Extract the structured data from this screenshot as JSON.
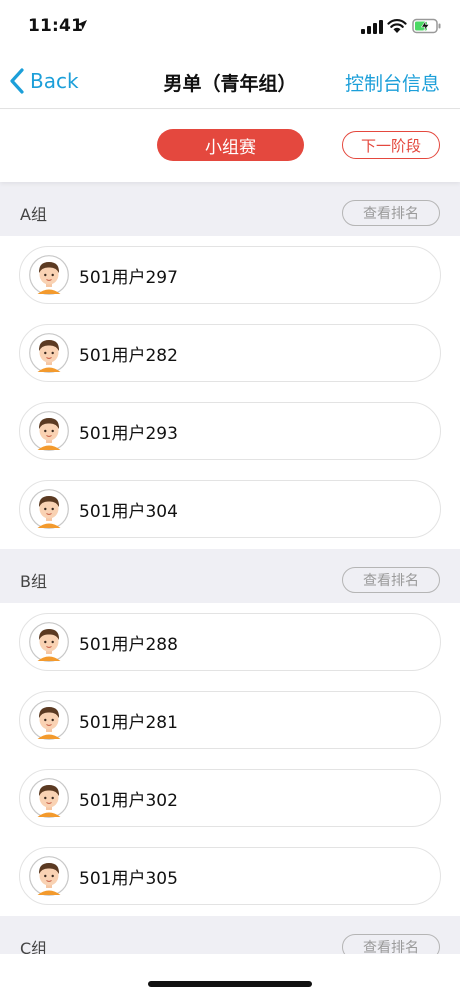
{
  "status_bar": {
    "time": "11:41"
  },
  "nav": {
    "back_label": "Back",
    "title": "男单（青年组）",
    "console_label": "控制台信息"
  },
  "stage": {
    "current": "小组赛",
    "next": "下一阶段"
  },
  "groups": [
    {
      "name": "A组",
      "rank_label": "查看排名",
      "players": [
        {
          "name": "501用户297"
        },
        {
          "name": "501用户282"
        },
        {
          "name": "501用户293"
        },
        {
          "name": "501用户304"
        }
      ]
    },
    {
      "name": "B组",
      "rank_label": "查看排名",
      "players": [
        {
          "name": "501用户288"
        },
        {
          "name": "501用户281"
        },
        {
          "name": "501用户302"
        },
        {
          "name": "501用户305"
        }
      ]
    },
    {
      "name": "C组",
      "rank_label": "查看排名",
      "players": []
    }
  ],
  "colors": {
    "accent": "#1c9fd9",
    "stage_red": "#e4483e",
    "group_bg": "#efeff4"
  }
}
